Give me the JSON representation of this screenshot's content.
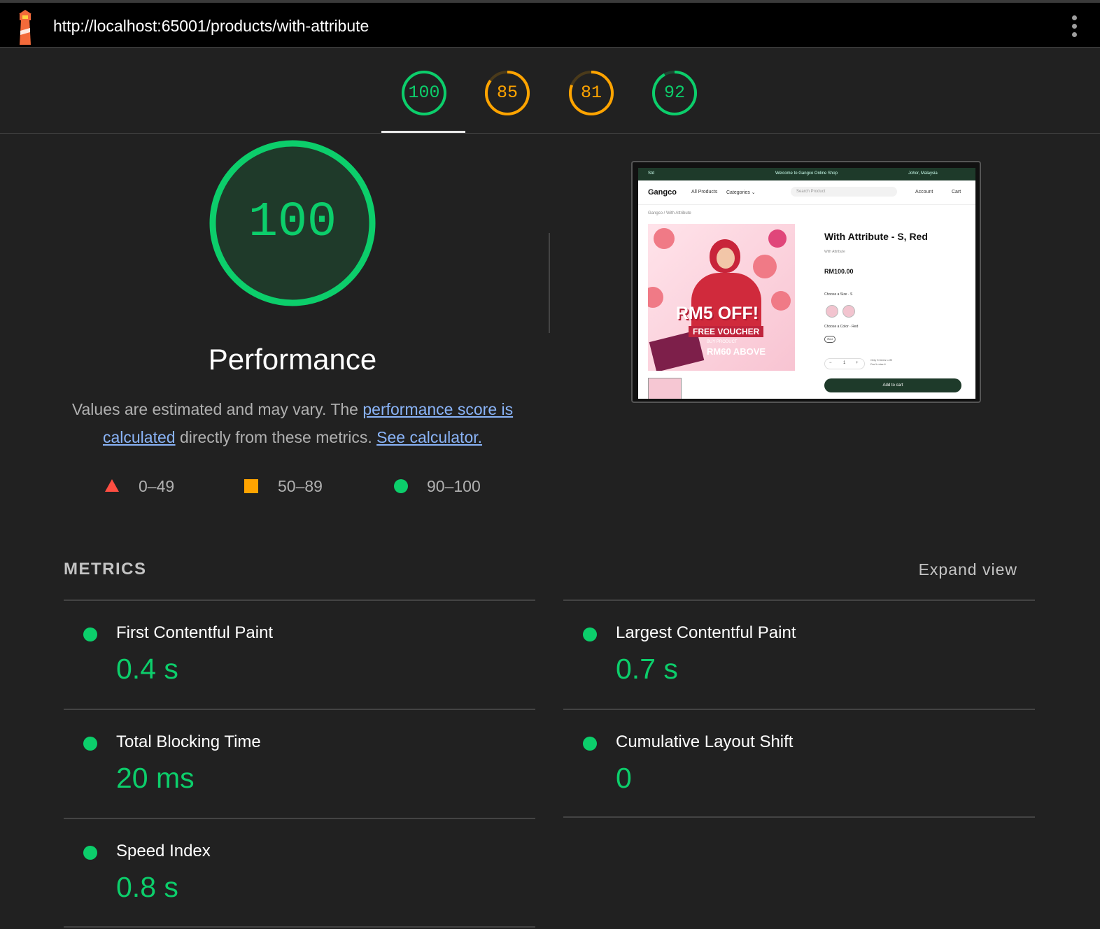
{
  "header": {
    "url": "http://localhost:65001/products/with-attribute",
    "logo_icon": "lighthouse-icon",
    "menu_icon": "kebab-menu-icon"
  },
  "category_gauges": [
    {
      "score": "100",
      "color": "#0cce6b",
      "fraction": 1.0
    },
    {
      "score": "85",
      "color": "#ffa400",
      "fraction": 0.85
    },
    {
      "score": "81",
      "color": "#ffa400",
      "fraction": 0.81
    },
    {
      "score": "92",
      "color": "#0cce6b",
      "fraction": 0.92
    }
  ],
  "performance": {
    "score": "100",
    "fraction": 1.0,
    "title": "Performance",
    "desc_prefix": "Values are estimated and may vary. The ",
    "link1": "performance score is calculated",
    "desc_mid": " directly from these metrics. ",
    "link2": "See calculator."
  },
  "legend": [
    {
      "range": "0–49",
      "shape": "triangle",
      "color": "#ff4e42"
    },
    {
      "range": "50–89",
      "shape": "square",
      "color": "#ffa400"
    },
    {
      "range": "90–100",
      "shape": "circle",
      "color": "#0cce6b"
    }
  ],
  "screenshot": {
    "strip_left": "Std",
    "strip_center": "Welcome to Gangco Online Shop",
    "strip_right": "Johor, Malaysia",
    "brand": "Gangco",
    "nav_all": "All Products",
    "nav_categories": "Categories ⌄",
    "search_placeholder": "Search Product",
    "account": "Account",
    "cart": "Cart",
    "breadcrumb": "Gangco / With Attribute",
    "banner_promo": "RM5 OFF!",
    "banner_voucher": "FREE VOUCHER",
    "banner_small": "BUY PRODUCT",
    "banner_above": "RM60 ABOVE",
    "product_title": "With Attribute - S, Red",
    "product_sub": "With Attribute",
    "price": "RM100.00",
    "size_label": "Choose a Size · S",
    "color_label": "Choose a Color · Red",
    "color_chip": "Red",
    "qty_minus": "−",
    "qty_value": "1",
    "qty_plus": "+",
    "stock_note_1": "Only 5 items Left!",
    "stock_note_2": "Don't miss it",
    "add_to_cart": "Add to cart"
  },
  "metrics": {
    "title": "METRICS",
    "expand": "Expand view",
    "items": [
      {
        "label": "First Contentful Paint",
        "value": "0.4 s"
      },
      {
        "label": "Largest Contentful Paint",
        "value": "0.7 s"
      },
      {
        "label": "Total Blocking Time",
        "value": "20 ms"
      },
      {
        "label": "Cumulative Layout Shift",
        "value": "0"
      },
      {
        "label": "Speed Index",
        "value": "0.8 s"
      }
    ]
  }
}
